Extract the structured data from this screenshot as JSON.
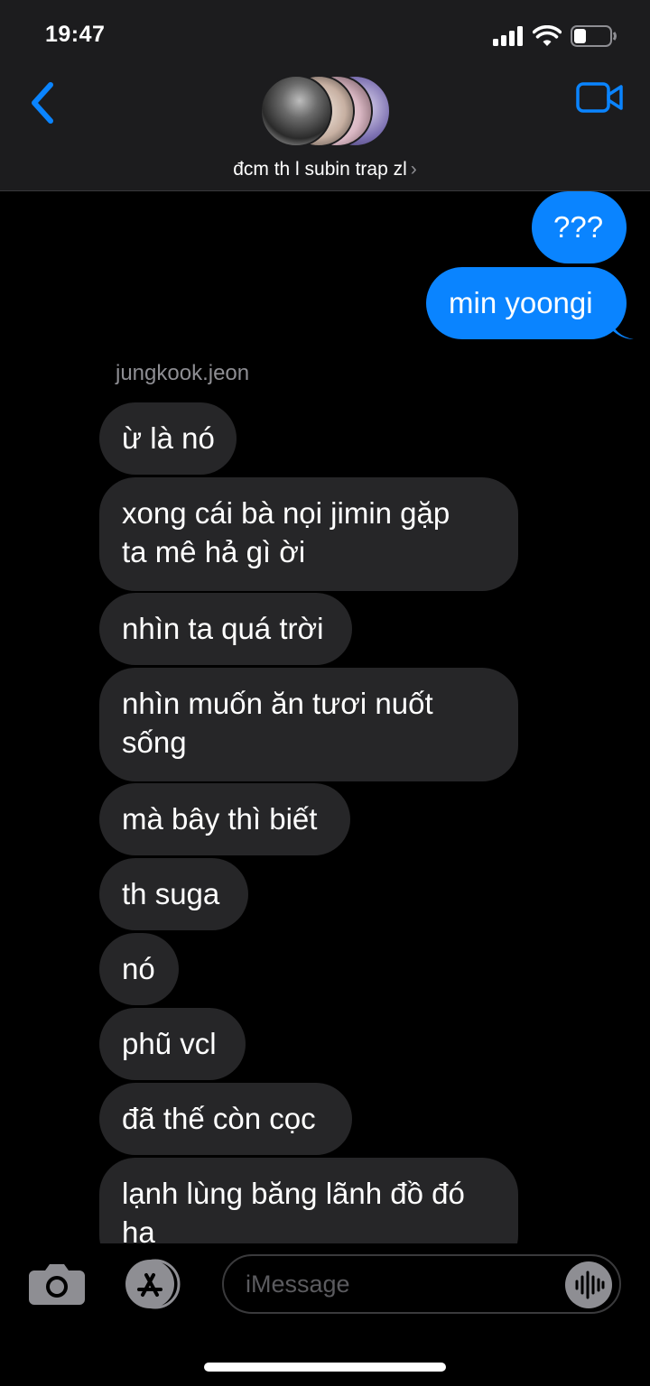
{
  "status_bar": {
    "time": "19:47",
    "battery_level": 0.35
  },
  "header": {
    "group_name": "đcm th l subin trap zl",
    "chevron": "›"
  },
  "colors": {
    "accent": "#0a84ff",
    "incoming_bubble": "#262628",
    "header_bg": "#1c1c1e"
  },
  "messages": {
    "outgoing": [
      {
        "text": "???"
      },
      {
        "text": "min yoongi"
      }
    ],
    "sender_name": "jungkook.jeon",
    "incoming": [
      {
        "line1": "ừ là nó"
      },
      {
        "line1": "xong cái bà nọi jimin gặp",
        "line2": "ta mê hả gì ời"
      },
      {
        "line1": "nhìn ta quá trời"
      },
      {
        "line1": "nhìn muốn ăn tươi nuốt",
        "line2": "sống"
      },
      {
        "line1": "mà bây thì biết"
      },
      {
        "line1": "th suga"
      },
      {
        "line1": "nó"
      },
      {
        "line1": "phũ vcl"
      },
      {
        "line1": "đã thế còn cọc"
      },
      {
        "line1": "lạnh lùng băng lãnh đồ đó",
        "line2": "ha"
      }
    ]
  },
  "composer": {
    "placeholder": "iMessage"
  },
  "icons": {
    "back": "chevron-left-icon",
    "video": "video-camera-icon",
    "camera": "camera-icon",
    "apps": "app-store-icon",
    "audio": "audio-waveform-icon"
  }
}
